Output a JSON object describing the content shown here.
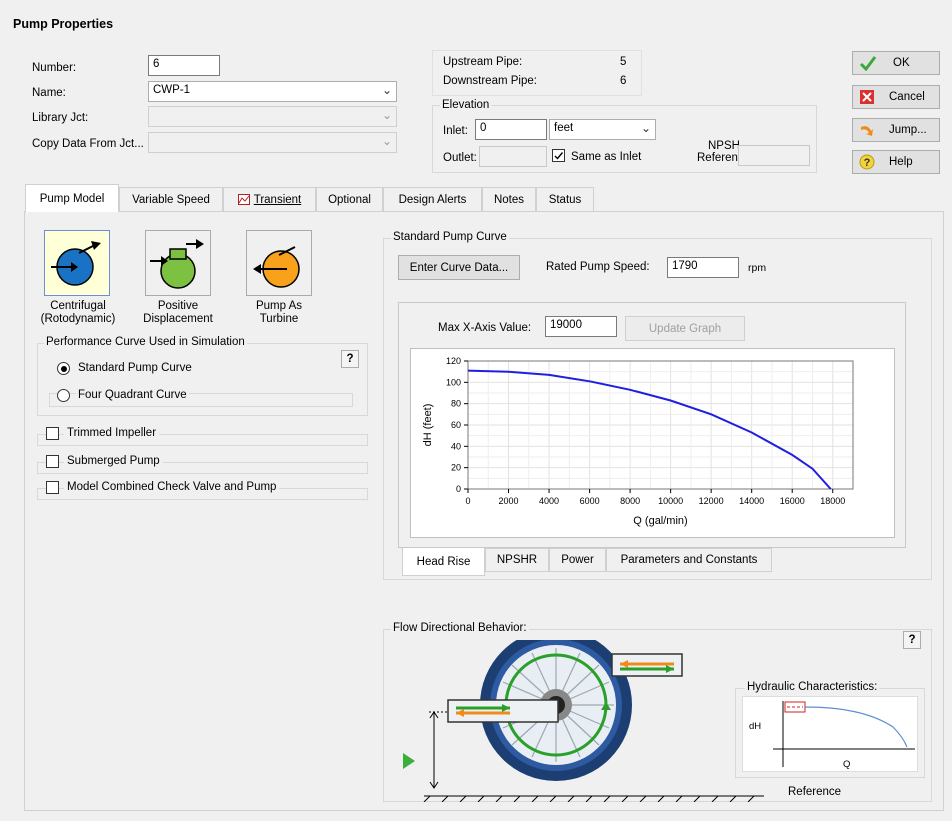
{
  "dialog": {
    "title": "Pump Properties"
  },
  "fields": {
    "number_label": "Number:",
    "number_value": "6",
    "name_label": "Name:",
    "name_value": "CWP-1",
    "library_label": "Library Jct:",
    "copy_label": "Copy Data From Jct..."
  },
  "pipes": {
    "upstream_label": "Upstream Pipe:",
    "upstream_value": "5",
    "downstream_label": "Downstream Pipe:",
    "downstream_value": "6"
  },
  "elevation": {
    "title": "Elevation",
    "inlet_label": "Inlet:",
    "inlet_value": "0",
    "unit": "feet",
    "outlet_label": "Outlet:",
    "same_as_inlet": "Same as Inlet",
    "npsh_line1": "NPSH",
    "npsh_line2": "Reference:"
  },
  "buttons": {
    "ok": "OK",
    "cancel": "Cancel",
    "jump": "Jump...",
    "help": "Help"
  },
  "tabs": [
    "Pump Model",
    "Variable Speed",
    "Transient",
    "Optional",
    "Design Alerts",
    "Notes",
    "Status"
  ],
  "pump_types": {
    "centrifugal_1": "Centrifugal",
    "centrifugal_2": "(Rotodynamic)",
    "pd_1": "Positive",
    "pd_2": "Displacement",
    "pat_1": "Pump As",
    "pat_2": "Turbine"
  },
  "performance": {
    "title": "Performance Curve Used in Simulation",
    "help": "?",
    "standard": "Standard Pump Curve",
    "four_quadrant": "Four Quadrant Curve"
  },
  "options": {
    "trimmed": "Trimmed Impeller",
    "submerged": "Submerged Pump",
    "check_valve": "Model Combined Check Valve and Pump"
  },
  "curve": {
    "title": "Standard Pump Curve",
    "enter_button": "Enter Curve Data...",
    "rated_speed_label": "Rated Pump Speed:",
    "rated_speed_value": "1790",
    "rated_speed_unit": "rpm",
    "max_x_label": "Max X-Axis Value:",
    "max_x_value": "19000",
    "update_button": "Update Graph"
  },
  "chart_data": {
    "type": "line",
    "xlabel": "Q (gal/min)",
    "ylabel": "dH (feet)",
    "xlim": [
      0,
      19000
    ],
    "ylim": [
      0,
      120
    ],
    "x_ticks": [
      0,
      2000,
      4000,
      6000,
      8000,
      10000,
      12000,
      14000,
      16000,
      18000
    ],
    "y_ticks": [
      0,
      20,
      40,
      60,
      80,
      100,
      120
    ],
    "grid": true,
    "series": [
      {
        "color": "#1f1fe0",
        "x": [
          0,
          2000,
          4000,
          6000,
          8000,
          10000,
          12000,
          14000,
          16000,
          17000,
          17900
        ],
        "y": [
          111,
          110,
          107,
          101,
          93,
          83,
          70,
          53,
          32,
          19,
          0
        ]
      }
    ]
  },
  "graph_tabs": [
    "Head Rise",
    "NPSHR",
    "Power",
    "Parameters and Constants"
  ],
  "flow": {
    "title": "Flow Directional Behavior:",
    "help": "?",
    "hydraulic_title": "Hydraulic Characteristics:",
    "dh": "dH",
    "q": "Q",
    "reference": "Reference"
  }
}
